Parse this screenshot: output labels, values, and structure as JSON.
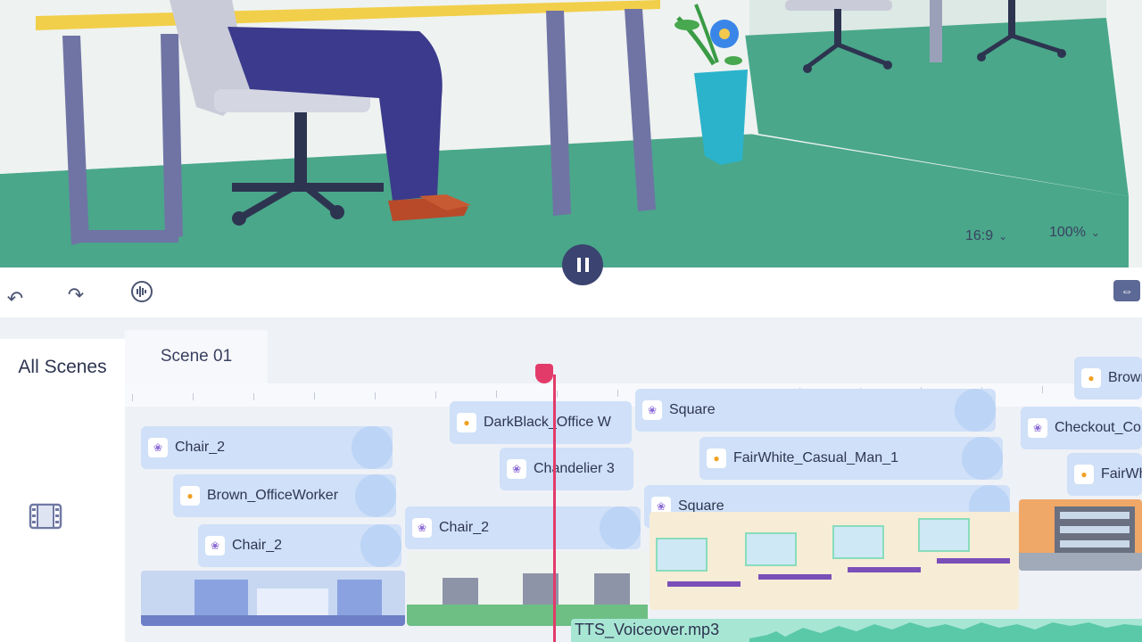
{
  "preview": {
    "aspect_ratio": "16:9",
    "zoom": "100%"
  },
  "playback": {
    "state": "playing"
  },
  "toolbar": {
    "undo_icon": "undo-icon",
    "redo_icon": "redo-icon",
    "voice_icon": "audio-wave-icon",
    "fit_icon": "fit-width-icon"
  },
  "timeline": {
    "all_scenes_label": "All Scenes",
    "scene_tab_label": "Scene 01",
    "clips": [
      {
        "label": "Chair_2",
        "kind": "prop"
      },
      {
        "label": "Brown_OfficeWorker",
        "kind": "char"
      },
      {
        "label": "Chair_2",
        "kind": "prop"
      },
      {
        "label": "DarkBlack_Office W",
        "kind": "char"
      },
      {
        "label": "Chandelier 3",
        "kind": "prop"
      },
      {
        "label": "Chair_2",
        "kind": "prop"
      },
      {
        "label": "Square",
        "kind": "prop"
      },
      {
        "label": "FairWhite_Casual_Man_1",
        "kind": "char"
      },
      {
        "label": "Square",
        "kind": "prop"
      },
      {
        "label": "Brown",
        "kind": "char"
      },
      {
        "label": "Checkout_Cour",
        "kind": "prop"
      },
      {
        "label": "FairWhi",
        "kind": "char"
      }
    ],
    "audio_track_label": "TTS_Voiceover.mp3"
  },
  "colors": {
    "accent": "#3b4370",
    "playhead": "#e23b6a",
    "clip_bg": "#cfe0f8",
    "floor": "#4aa78a"
  }
}
